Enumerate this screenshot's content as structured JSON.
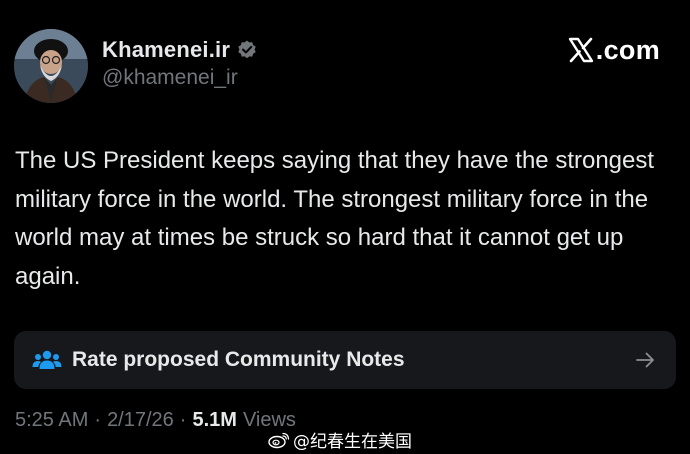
{
  "profile": {
    "display_name": "Khamenei.ir",
    "handle": "@khamenei_ir",
    "avatar_icon": "profile-photo",
    "verified_icon": "verified-badge-icon",
    "verified_color": "#71767b"
  },
  "brand": {
    "text": ".com",
    "logo_icon": "x-logo-icon"
  },
  "tweet": {
    "text": "The US President keeps saying that they have the strongest military force in the world. The strongest military force in the world may at times be struck so hard that it cannot get up again."
  },
  "community_notes": {
    "label": "Rate proposed Community Notes",
    "icon": "people-icon",
    "icon_color": "#1d9bf0",
    "arrow_icon": "arrow-right-icon"
  },
  "meta": {
    "time": "5:25 AM",
    "date": "2/17/26",
    "separator": "·",
    "views_count": "5.1M",
    "views_label": "Views"
  },
  "watermark": {
    "text": "@纪春生在美国",
    "icon": "weibo-icon"
  },
  "colors": {
    "background": "#000000",
    "primary_text": "#e7e9ea",
    "secondary_text": "#71767b",
    "card_background": "#16181c"
  }
}
